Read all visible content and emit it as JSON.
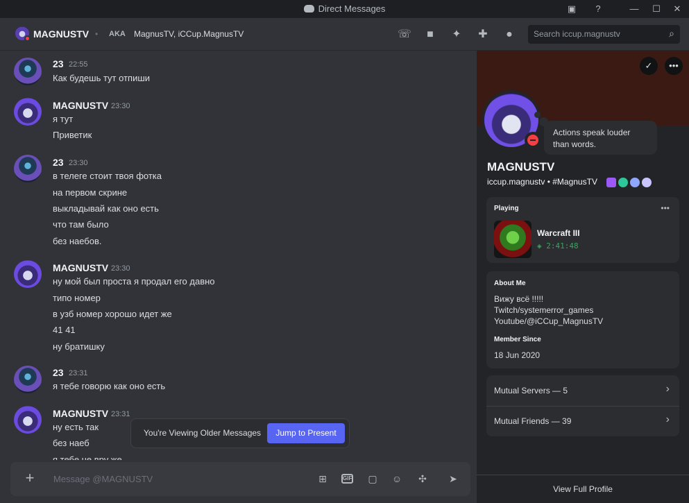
{
  "window": {
    "title": "Direct Messages"
  },
  "header": {
    "name": "MAGNUSTV",
    "aka_label": "AKA",
    "aka_names": "MagnusTV, iCCup.MagnusTV",
    "search_placeholder": "Search iccup.magnustv"
  },
  "messages": [
    {
      "author": "23",
      "time": "22:55",
      "lines": [
        "Как будешь тут отпиши"
      ]
    },
    {
      "author": "MAGNUSTV",
      "time": "23:30",
      "lines": [
        "я тут",
        "Приветик"
      ]
    },
    {
      "author": "23",
      "time": "23:30",
      "lines": [
        "в телеге стоит твоя фотка",
        "на первом скрине",
        "выкладывай как оно есть",
        "что там было",
        "без наебов."
      ]
    },
    {
      "author": "MAGNUSTV",
      "time": "23:30",
      "lines": [
        "ну мой был проста я продал его давно",
        "типо номер",
        "в узб номер хорошо идет же",
        "41 41",
        "ну братишку"
      ]
    },
    {
      "author": "23",
      "time": "23:31",
      "lines": [
        "я тебе говорю как оно есть"
      ]
    },
    {
      "author": "MAGNUSTV",
      "time": "23:31",
      "lines": [
        "ну есть так",
        "без наеб",
        "я тебе не вру же"
      ]
    }
  ],
  "older_banner": {
    "text": "You're Viewing Older Messages",
    "button": "Jump to Present"
  },
  "composer": {
    "placeholder": "Message @MAGNUSTV"
  },
  "profile": {
    "status_text": "Actions speak louder than words.",
    "display_name": "MAGNUSTV",
    "username_line": "iccup.magnustv • #MagnusTV",
    "playing_header": "Playing",
    "game_name": "Warcraft III",
    "game_time": "2:41:48",
    "about_header": "About Me",
    "about_lines": [
      "Вижу всё !!!!!",
      "Twitch/systemerror_games",
      "Youtube/@iCCup_MagnusTV"
    ],
    "member_since_header": "Member Since",
    "member_since": "18 Jun 2020",
    "mutual_servers": "Mutual Servers — 5",
    "mutual_friends": "Mutual Friends — 39",
    "view_full_profile": "View Full Profile"
  },
  "colors": {
    "accent": "#5865f2",
    "dnd": "#f23f43",
    "playing": "#3ba55d"
  }
}
